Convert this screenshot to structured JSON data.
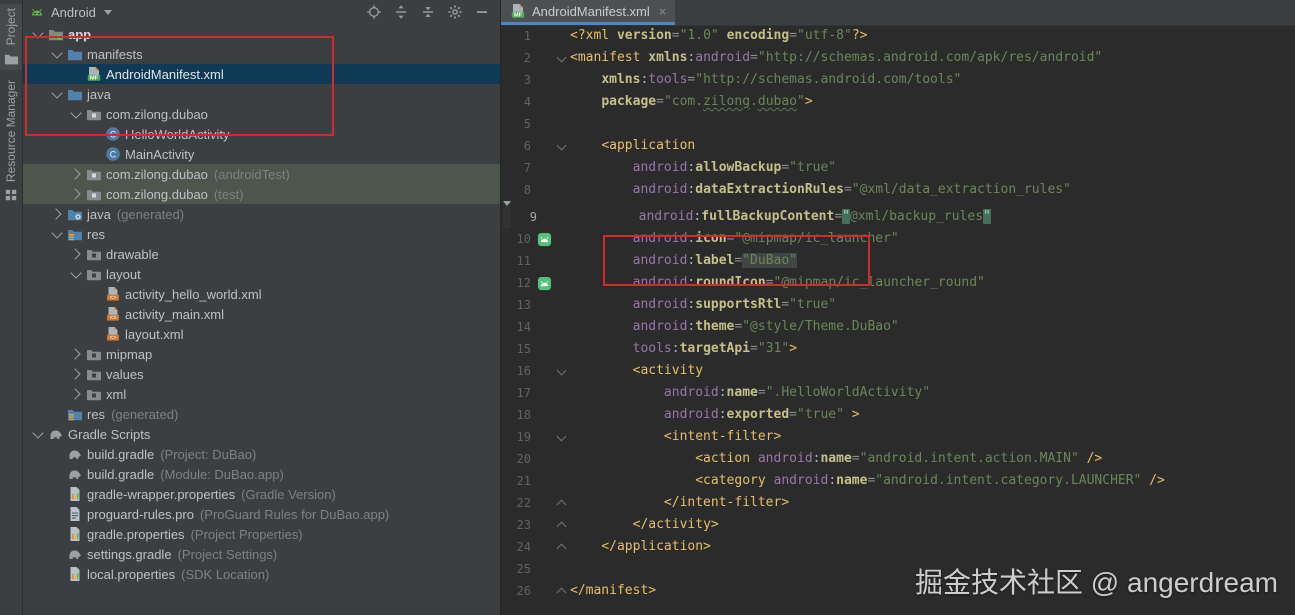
{
  "colors": {
    "panel_bg": "#3c3f41",
    "editor_bg": "#2b2b2b",
    "selection_blue": "#0f3a55",
    "tab_accent_blue": "#4a88c7",
    "annotation_red": "#d22b2b",
    "sage_row": "#4c564d",
    "tag_gold": "#e8bf6a",
    "string_green": "#6a8759",
    "namespace_purple": "#9876aa"
  },
  "stripe": {
    "tabs": [
      {
        "label": "Project",
        "icon": "project-folder-icon"
      },
      {
        "label": "Resource Manager",
        "icon": "resource-manager-icon"
      }
    ]
  },
  "project_panel": {
    "selector": {
      "label": "Android",
      "icon": "android-robot-icon"
    },
    "toolbar_icons": [
      "locate-icon",
      "expand-all-icon",
      "collapse-all-icon",
      "settings-gear-icon",
      "hide-panel-icon"
    ],
    "tree": [
      {
        "i": 0,
        "c": "down",
        "icon": "app-folder-icon",
        "label": "app",
        "bold": true
      },
      {
        "i": 1,
        "c": "down",
        "icon": "folder-blue-icon",
        "label": "manifests"
      },
      {
        "i": 2,
        "c": "",
        "icon": "manifest-file-icon",
        "label": "AndroidManifest.xml",
        "sel": true
      },
      {
        "i": 1,
        "c": "down",
        "icon": "folder-blue-icon",
        "label": "java"
      },
      {
        "i": 2,
        "c": "down",
        "icon": "package-folder-icon",
        "label": "com.zilong.dubao"
      },
      {
        "i": 3,
        "c": "",
        "icon": "class-icon",
        "label": "HelloWorldActivity"
      },
      {
        "i": 3,
        "c": "",
        "icon": "class-icon",
        "label": "MainActivity"
      },
      {
        "i": 2,
        "c": "right",
        "icon": "package-folder-icon",
        "label": "com.zilong.dubao",
        "ann": "(androidTest)",
        "bg": "sage"
      },
      {
        "i": 2,
        "c": "right",
        "icon": "package-folder-icon",
        "label": "com.zilong.dubao",
        "ann": "(test)",
        "bg": "sage"
      },
      {
        "i": 1,
        "c": "right",
        "icon": "generated-folder-icon",
        "label": "java",
        "ann": "(generated)"
      },
      {
        "i": 1,
        "c": "down",
        "icon": "res-folder-icon",
        "label": "res"
      },
      {
        "i": 2,
        "c": "right",
        "icon": "folder-gray-icon",
        "label": "drawable"
      },
      {
        "i": 2,
        "c": "down",
        "icon": "folder-gray-icon",
        "label": "layout"
      },
      {
        "i": 3,
        "c": "",
        "icon": "xml-file-icon",
        "label": "activity_hello_world.xml"
      },
      {
        "i": 3,
        "c": "",
        "icon": "xml-file-icon",
        "label": "activity_main.xml"
      },
      {
        "i": 3,
        "c": "",
        "icon": "xml-file-icon",
        "label": "layout.xml"
      },
      {
        "i": 2,
        "c": "right",
        "icon": "folder-gray-icon",
        "label": "mipmap"
      },
      {
        "i": 2,
        "c": "right",
        "icon": "folder-gray-icon",
        "label": "values"
      },
      {
        "i": 2,
        "c": "right",
        "icon": "folder-gray-icon",
        "label": "xml"
      },
      {
        "i": 1,
        "c": "",
        "icon": "res-folder-icon",
        "label": "res",
        "ann": "(generated)"
      },
      {
        "i": 0,
        "c": "down",
        "icon": "gradle-icon",
        "label": "Gradle Scripts"
      },
      {
        "i": 1,
        "c": "",
        "icon": "gradle-icon",
        "label": "build.gradle",
        "ann": "(Project: DuBao)"
      },
      {
        "i": 1,
        "c": "",
        "icon": "gradle-icon",
        "label": "build.gradle",
        "ann": "(Module: DuBao.app)"
      },
      {
        "i": 1,
        "c": "",
        "icon": "properties-file-icon",
        "label": "gradle-wrapper.properties",
        "ann": "(Gradle Version)"
      },
      {
        "i": 1,
        "c": "",
        "icon": "text-file-icon",
        "label": "proguard-rules.pro",
        "ann": "(ProGuard Rules for DuBao.app)"
      },
      {
        "i": 1,
        "c": "",
        "icon": "properties-file-icon",
        "label": "gradle.properties",
        "ann": "(Project Properties)"
      },
      {
        "i": 1,
        "c": "",
        "icon": "gradle-icon",
        "label": "settings.gradle",
        "ann": "(Project Settings)"
      },
      {
        "i": 1,
        "c": "",
        "icon": "properties-file-icon",
        "label": "local.properties",
        "ann": "(SDK Location)"
      }
    ]
  },
  "editor": {
    "tab": {
      "title": "AndroidManifest.xml",
      "icon": "manifest-file-icon",
      "close": "×"
    },
    "lines": [
      {
        "n": 1,
        "seg": [
          [
            "tag",
            "<?xml "
          ],
          [
            "attr",
            "version"
          ],
          [
            "eq",
            "="
          ],
          [
            "str",
            "\"1.0\""
          ],
          [
            "pln",
            " "
          ],
          [
            "attr",
            "encoding"
          ],
          [
            "eq",
            "="
          ],
          [
            "str",
            "\"utf-8\""
          ],
          [
            "tag",
            "?>"
          ]
        ]
      },
      {
        "n": 2,
        "fold": "start",
        "seg": [
          [
            "tag",
            "<manifest "
          ],
          [
            "attr",
            "xmlns"
          ],
          [
            "pln",
            ":"
          ],
          [
            "ns",
            "android"
          ],
          [
            "eq",
            "="
          ],
          [
            "str",
            "\"http://schemas.android.com/apk/res/android\""
          ]
        ]
      },
      {
        "n": 3,
        "seg": [
          [
            "pln",
            "    "
          ],
          [
            "attr",
            "xmlns"
          ],
          [
            "pln",
            ":"
          ],
          [
            "ns",
            "tools"
          ],
          [
            "eq",
            "="
          ],
          [
            "str",
            "\"http://schemas.android.com/tools\""
          ]
        ]
      },
      {
        "n": 4,
        "seg": [
          [
            "pln",
            "    "
          ],
          [
            "attr",
            "package"
          ],
          [
            "eq",
            "="
          ],
          [
            "str",
            "\"com."
          ],
          [
            "typo",
            "zilong"
          ],
          [
            "str",
            "."
          ],
          [
            "typo",
            "dubao"
          ],
          [
            "str",
            "\""
          ],
          [
            "tag",
            ">"
          ]
        ]
      },
      {
        "n": 5,
        "seg": []
      },
      {
        "n": 6,
        "fold": "start",
        "seg": [
          [
            "pln",
            "    "
          ],
          [
            "tag",
            "<application"
          ]
        ]
      },
      {
        "n": 7,
        "seg": [
          [
            "pln",
            "        "
          ],
          [
            "ns",
            "android"
          ],
          [
            "pln",
            ":"
          ],
          [
            "attr",
            "allowBackup"
          ],
          [
            "eq",
            "="
          ],
          [
            "str",
            "\"true\""
          ]
        ]
      },
      {
        "n": 8,
        "seg": [
          [
            "pln",
            "        "
          ],
          [
            "ns",
            "android"
          ],
          [
            "pln",
            ":"
          ],
          [
            "attr",
            "dataExtractionRules"
          ],
          [
            "eq",
            "="
          ],
          [
            "str",
            "\"@xml/data_extraction_rules\""
          ]
        ]
      },
      {
        "n": 9,
        "caret": true,
        "seg": [
          [
            "pln",
            "        "
          ],
          [
            "ns",
            "android"
          ],
          [
            "pln",
            ":"
          ],
          [
            "attr",
            "fullBackupContent"
          ],
          [
            "eq",
            "="
          ],
          [
            "strhl",
            "\""
          ],
          [
            "str",
            "@xml/backup_rules"
          ],
          [
            "strhl",
            "\""
          ]
        ]
      },
      {
        "n": 10,
        "gicon": true,
        "seg": [
          [
            "pln",
            "        "
          ],
          [
            "ns",
            "android"
          ],
          [
            "pln",
            ":"
          ],
          [
            "attr",
            "icon"
          ],
          [
            "eq",
            "="
          ],
          [
            "str",
            "\"@mipmap/ic_launcher\""
          ]
        ]
      },
      {
        "n": 11,
        "seg": [
          [
            "pln",
            "        "
          ],
          [
            "ns",
            "android"
          ],
          [
            "pln",
            ":"
          ],
          [
            "attr",
            "label"
          ],
          [
            "eq",
            "="
          ],
          [
            "strbox",
            "\"DuBao\""
          ]
        ]
      },
      {
        "n": 12,
        "gicon": true,
        "seg": [
          [
            "pln",
            "        "
          ],
          [
            "ns",
            "android"
          ],
          [
            "pln",
            ":"
          ],
          [
            "attr",
            "roundIcon"
          ],
          [
            "eq",
            "="
          ],
          [
            "str",
            "\"@mipmap/ic_launcher_round\""
          ]
        ]
      },
      {
        "n": 13,
        "seg": [
          [
            "pln",
            "        "
          ],
          [
            "ns",
            "android"
          ],
          [
            "pln",
            ":"
          ],
          [
            "attr",
            "supportsRtl"
          ],
          [
            "eq",
            "="
          ],
          [
            "str",
            "\"true\""
          ]
        ]
      },
      {
        "n": 14,
        "seg": [
          [
            "pln",
            "        "
          ],
          [
            "ns",
            "android"
          ],
          [
            "pln",
            ":"
          ],
          [
            "attr",
            "theme"
          ],
          [
            "eq",
            "="
          ],
          [
            "str",
            "\"@style/Theme.DuBao\""
          ]
        ]
      },
      {
        "n": 15,
        "seg": [
          [
            "pln",
            "        "
          ],
          [
            "ns",
            "tools"
          ],
          [
            "pln",
            ":"
          ],
          [
            "attr",
            "targetApi"
          ],
          [
            "eq",
            "="
          ],
          [
            "str",
            "\"31\""
          ],
          [
            "tag",
            ">"
          ]
        ]
      },
      {
        "n": 16,
        "fold": "start",
        "seg": [
          [
            "pln",
            "        "
          ],
          [
            "tag",
            "<activity"
          ]
        ]
      },
      {
        "n": 17,
        "seg": [
          [
            "pln",
            "            "
          ],
          [
            "ns",
            "android"
          ],
          [
            "pln",
            ":"
          ],
          [
            "attr",
            "name"
          ],
          [
            "eq",
            "="
          ],
          [
            "str",
            "\".HelloWorldActivity\""
          ]
        ]
      },
      {
        "n": 18,
        "seg": [
          [
            "pln",
            "            "
          ],
          [
            "ns",
            "android"
          ],
          [
            "pln",
            ":"
          ],
          [
            "attr",
            "exported"
          ],
          [
            "eq",
            "="
          ],
          [
            "str",
            "\"true\""
          ],
          [
            "pln",
            " "
          ],
          [
            "tag",
            ">"
          ]
        ]
      },
      {
        "n": 19,
        "fold": "start",
        "seg": [
          [
            "pln",
            "            "
          ],
          [
            "tag",
            "<intent-filter>"
          ]
        ]
      },
      {
        "n": 20,
        "seg": [
          [
            "pln",
            "                "
          ],
          [
            "tag",
            "<action "
          ],
          [
            "ns",
            "android"
          ],
          [
            "pln",
            ":"
          ],
          [
            "attr",
            "name"
          ],
          [
            "eq",
            "="
          ],
          [
            "str",
            "\"android.intent.action.MAIN\""
          ],
          [
            "pln",
            " "
          ],
          [
            "tag",
            "/>"
          ]
        ]
      },
      {
        "n": 21,
        "seg": [
          [
            "pln",
            "                "
          ],
          [
            "tag",
            "<category "
          ],
          [
            "ns",
            "android"
          ],
          [
            "pln",
            ":"
          ],
          [
            "attr",
            "name"
          ],
          [
            "eq",
            "="
          ],
          [
            "str",
            "\"android.intent.category.LAUNCHER\""
          ],
          [
            "pln",
            " "
          ],
          [
            "tag",
            "/>"
          ]
        ]
      },
      {
        "n": 22,
        "fold": "end",
        "seg": [
          [
            "pln",
            "            "
          ],
          [
            "tag",
            "</intent-filter>"
          ]
        ]
      },
      {
        "n": 23,
        "fold": "end",
        "seg": [
          [
            "pln",
            "        "
          ],
          [
            "tag",
            "</activity>"
          ]
        ]
      },
      {
        "n": 24,
        "fold": "end",
        "seg": [
          [
            "pln",
            "    "
          ],
          [
            "tag",
            "</application>"
          ]
        ]
      },
      {
        "n": 25,
        "seg": []
      },
      {
        "n": 26,
        "fold": "end",
        "seg": [
          [
            "tag",
            "</manifest>"
          ]
        ]
      }
    ]
  },
  "watermark": {
    "text": "掘金技术社区 @ angerdream"
  }
}
